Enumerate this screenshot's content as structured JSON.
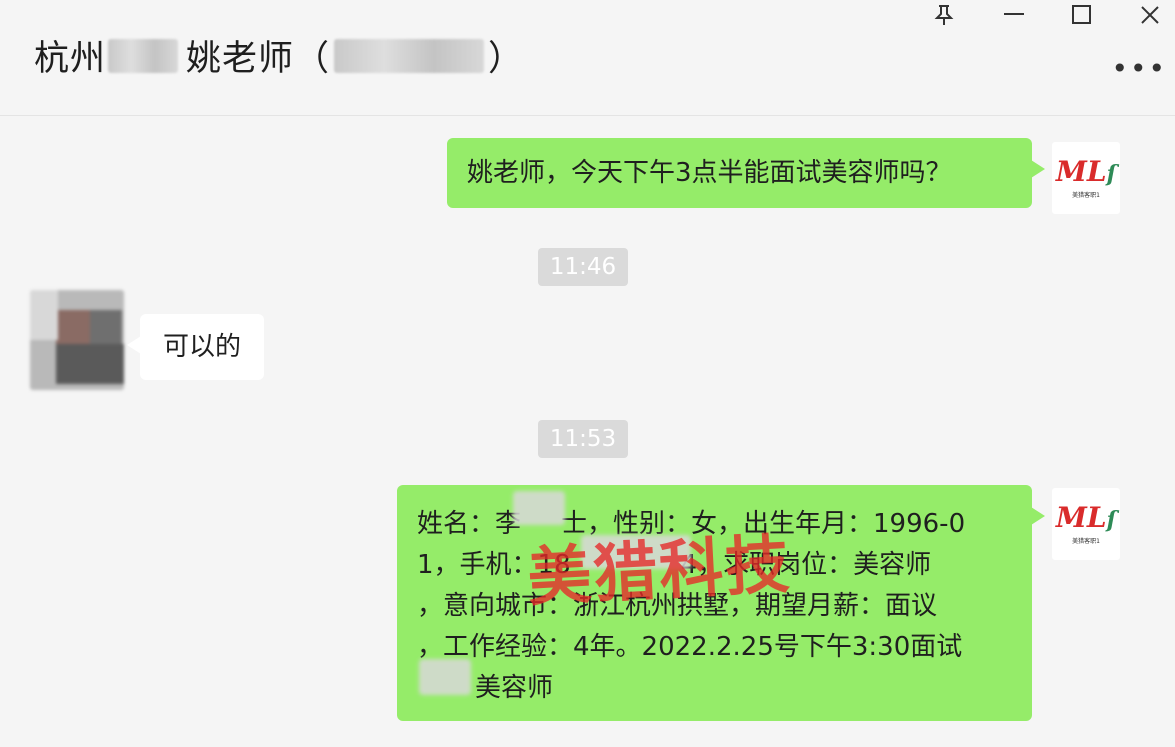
{
  "header": {
    "title_city": "杭州",
    "title_name": "姚老师（",
    "title_close": "）"
  },
  "window_controls": {
    "pin_icon": "pin-icon",
    "minimize_icon": "minimize-icon",
    "maximize_icon": "maximize-icon",
    "close_icon": "close-icon",
    "more_icon": "more-icon"
  },
  "messages": [
    {
      "side": "right",
      "text": "姚老师，今天下午3点半能面试美容师吗？"
    },
    {
      "time": "11:46"
    },
    {
      "side": "left",
      "text": "可以的"
    },
    {
      "time": "11:53"
    },
    {
      "side": "right",
      "lines": [
        "姓名：李",
        "士，性别：女，出生年月：1996-0",
        "1，手机：18",
        "4，求职岗位：美容师",
        "，意向城市：浙江杭州拱墅，期望月薪：面议",
        "，工作经验：4年。2022.2.25号下午3:30面试",
        "美容师"
      ]
    }
  ],
  "avatar_logo": {
    "text": "ML",
    "caption": "美猎客职1"
  },
  "watermark": "美猎科技",
  "colors": {
    "bubble_green": "#95ec69",
    "bubble_white": "#ffffff",
    "background": "#f5f5f5",
    "watermark": "#e62828"
  }
}
